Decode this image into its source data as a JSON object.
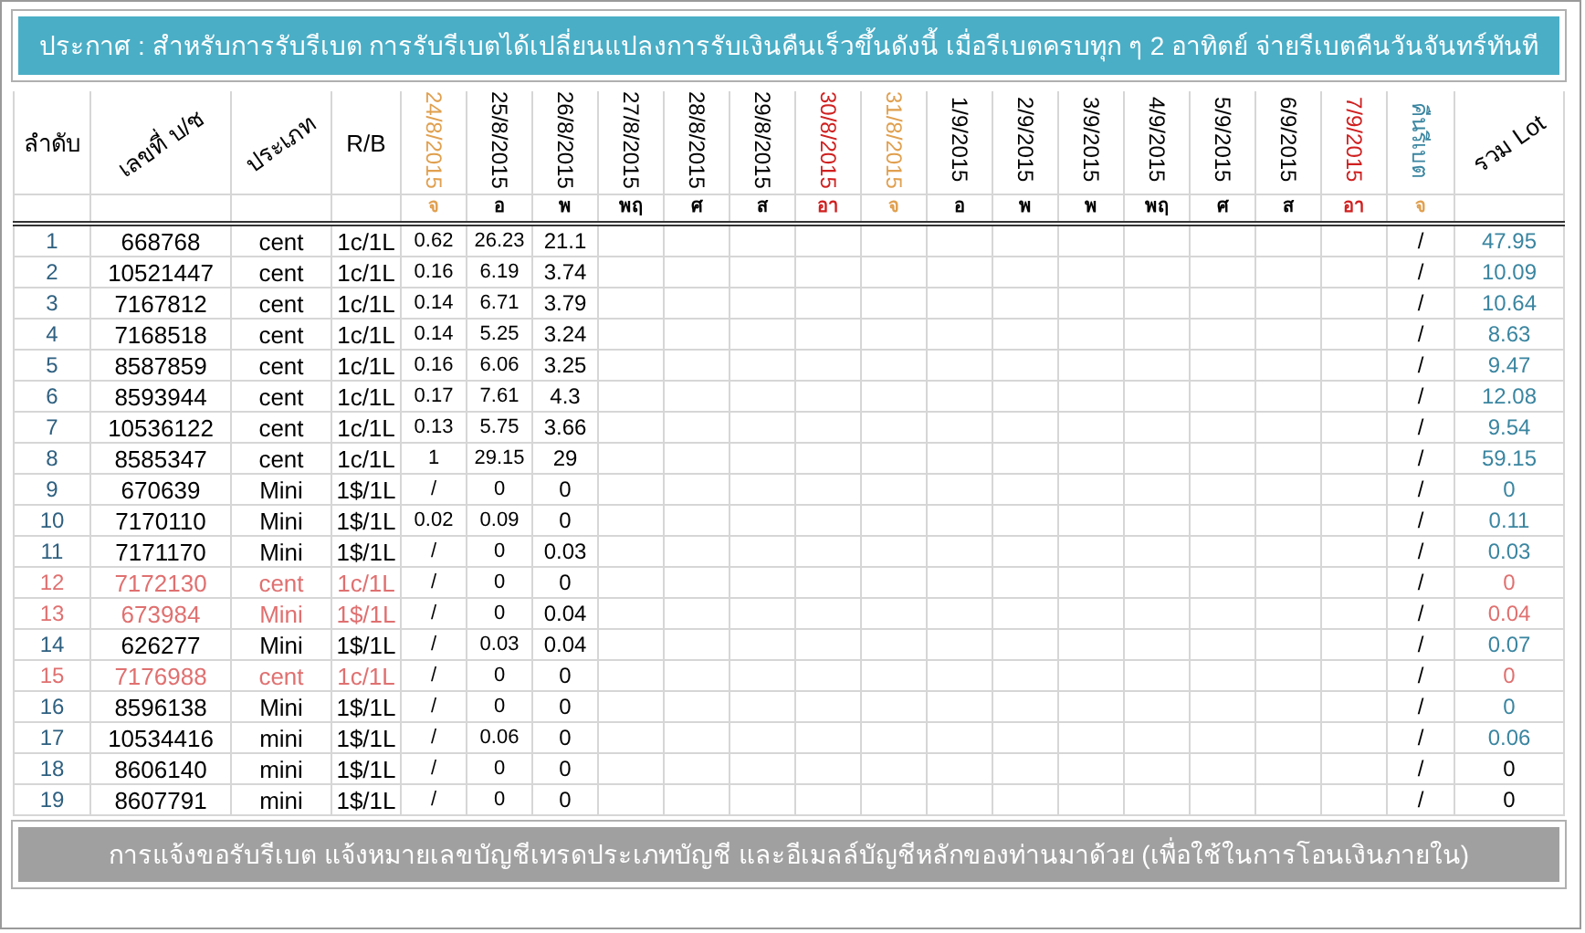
{
  "announcement": "ประกาศ : สำหรับการรับรีเบต  การรับรีเบตได้เปลี่ยนแปลงการรับเงินคืนเร็วขึ้นดังนี้   เมื่อรีเบตครบทุก ๆ 2 อาทิตย์ จ่ายรีเบตคืนวันจันทร์ทันที",
  "columns": {
    "no": "ลำดับ",
    "account": "เลขที่ บ/ช",
    "type": "ประเภท",
    "rb": "R/B",
    "refund": "คืนรีเบต",
    "refund_day": "จ",
    "total": "รวม Lot"
  },
  "dates": [
    {
      "date": "24/8/2015",
      "day": "จ",
      "color": "#e0a050"
    },
    {
      "date": "25/8/2015",
      "day": "อ",
      "color": "#000000"
    },
    {
      "date": "26/8/2015",
      "day": "พ",
      "color": "#000000"
    },
    {
      "date": "27/8/2015",
      "day": "พฤ",
      "color": "#000000"
    },
    {
      "date": "28/8/2015",
      "day": "ศ",
      "color": "#000000"
    },
    {
      "date": "29/8/2015",
      "day": "ส",
      "color": "#000000"
    },
    {
      "date": "30/8/2015",
      "day": "อา",
      "color": "#d02020"
    },
    {
      "date": "31/8/2015",
      "day": "จ",
      "color": "#e0a050"
    },
    {
      "date": "1/9/2015",
      "day": "อ",
      "color": "#000000"
    },
    {
      "date": "2/9/2015",
      "day": "พ",
      "color": "#000000"
    },
    {
      "date": "3/9/2015",
      "day": "พ",
      "color": "#000000"
    },
    {
      "date": "4/9/2015",
      "day": "พฤ",
      "color": "#000000"
    },
    {
      "date": "5/9/2015",
      "day": "ศ",
      "color": "#000000"
    },
    {
      "date": "6/9/2015",
      "day": "ส",
      "color": "#000000"
    },
    {
      "date": "7/9/2015",
      "day": "อา",
      "color": "#d02020"
    }
  ],
  "rows": [
    {
      "no": "1",
      "account": "668768",
      "type": "cent",
      "rb": "1c/1L",
      "values": [
        "0.62",
        "26.23",
        "21.1"
      ],
      "refund": "/",
      "total": "47.95",
      "inactive": false,
      "color": "#3a85a0"
    },
    {
      "no": "2",
      "account": "10521447",
      "type": "cent",
      "rb": "1c/1L",
      "values": [
        "0.16",
        "6.19",
        "3.74"
      ],
      "refund": "/",
      "total": "10.09",
      "inactive": false,
      "color": "#3a85a0"
    },
    {
      "no": "3",
      "account": "7167812",
      "type": "cent",
      "rb": "1c/1L",
      "values": [
        "0.14",
        "6.71",
        "3.79"
      ],
      "refund": "/",
      "total": "10.64",
      "inactive": false,
      "color": "#3a85a0"
    },
    {
      "no": "4",
      "account": "7168518",
      "type": "cent",
      "rb": "1c/1L",
      "values": [
        "0.14",
        "5.25",
        "3.24"
      ],
      "refund": "/",
      "total": "8.63",
      "inactive": false,
      "color": "#3a85a0"
    },
    {
      "no": "5",
      "account": "8587859",
      "type": "cent",
      "rb": "1c/1L",
      "values": [
        "0.16",
        "6.06",
        "3.25"
      ],
      "refund": "/",
      "total": "9.47",
      "inactive": false,
      "color": "#3a85a0"
    },
    {
      "no": "6",
      "account": "8593944",
      "type": "cent",
      "rb": "1c/1L",
      "values": [
        "0.17",
        "7.61",
        "4.3"
      ],
      "refund": "/",
      "total": "12.08",
      "inactive": false,
      "color": "#3a85a0"
    },
    {
      "no": "7",
      "account": "10536122",
      "type": "cent",
      "rb": "1c/1L",
      "values": [
        "0.13",
        "5.75",
        "3.66"
      ],
      "refund": "/",
      "total": "9.54",
      "inactive": false,
      "color": "#3a85a0"
    },
    {
      "no": "8",
      "account": "8585347",
      "type": "cent",
      "rb": "1c/1L",
      "values": [
        "1",
        "29.15",
        "29"
      ],
      "refund": "/",
      "total": "59.15",
      "inactive": false,
      "color": "#3a85a0"
    },
    {
      "no": "9",
      "account": "670639",
      "type": "Mini",
      "rb": "1$/1L",
      "values": [
        "/",
        "0",
        "0"
      ],
      "refund": "/",
      "total": "0",
      "inactive": false,
      "color": "#3a85a0"
    },
    {
      "no": "10",
      "account": "7170110",
      "type": "Mini",
      "rb": "1$/1L",
      "values": [
        "0.02",
        "0.09",
        "0"
      ],
      "refund": "/",
      "total": "0.11",
      "inactive": false,
      "color": "#3a85a0"
    },
    {
      "no": "11",
      "account": "7171170",
      "type": "Mini",
      "rb": "1$/1L",
      "values": [
        "/",
        "0",
        "0.03"
      ],
      "refund": "/",
      "total": "0.03",
      "inactive": false,
      "color": "#3a85a0"
    },
    {
      "no": "12",
      "account": "7172130",
      "type": "cent",
      "rb": "1c/1L",
      "values": [
        "/",
        "0",
        "0"
      ],
      "refund": "/",
      "total": "0",
      "inactive": true,
      "color": "#e07070"
    },
    {
      "no": "13",
      "account": "673984",
      "type": "Mini",
      "rb": "1$/1L",
      "values": [
        "/",
        "0",
        "0.04"
      ],
      "refund": "/",
      "total": "0.04",
      "inactive": true,
      "color": "#e07070"
    },
    {
      "no": "14",
      "account": "626277",
      "type": "Mini",
      "rb": "1$/1L",
      "values": [
        "/",
        "0.03",
        "0.04"
      ],
      "refund": "/",
      "total": "0.07",
      "inactive": false,
      "color": "#3a85a0"
    },
    {
      "no": "15",
      "account": "7176988",
      "type": "cent",
      "rb": "1c/1L",
      "values": [
        "/",
        "0",
        "0"
      ],
      "refund": "/",
      "total": "0",
      "inactive": true,
      "color": "#e07070"
    },
    {
      "no": "16",
      "account": "8596138",
      "type": "Mini",
      "rb": "1$/1L",
      "values": [
        "/",
        "0",
        "0"
      ],
      "refund": "/",
      "total": "0",
      "inactive": false,
      "color": "#3a85a0"
    },
    {
      "no": "17",
      "account": "10534416",
      "type": "mini",
      "rb": "1$/1L",
      "values": [
        "/",
        "0.06",
        "0"
      ],
      "refund": "/",
      "total": "0.06",
      "inactive": false,
      "color": "#3a85a0"
    },
    {
      "no": "18",
      "account": "8606140",
      "type": "mini",
      "rb": "1$/1L",
      "values": [
        "/",
        "0",
        "0"
      ],
      "refund": "/",
      "total": "0",
      "inactive": false,
      "color": "#000000"
    },
    {
      "no": "19",
      "account": "8607791",
      "type": "mini",
      "rb": "1$/1L",
      "values": [
        "/",
        "0",
        "0"
      ],
      "refund": "/",
      "total": "0",
      "inactive": false,
      "color": "#000000"
    }
  ],
  "footer": "การแจ้งขอรับรีเบต  แจ้งหมายเลขบัญชีเทรดประเภทบัญชี และอีเมลล์บัญชีหลักของท่านมาด้วย   (เพื่อใช้ในการโอนเงินภายใน)"
}
